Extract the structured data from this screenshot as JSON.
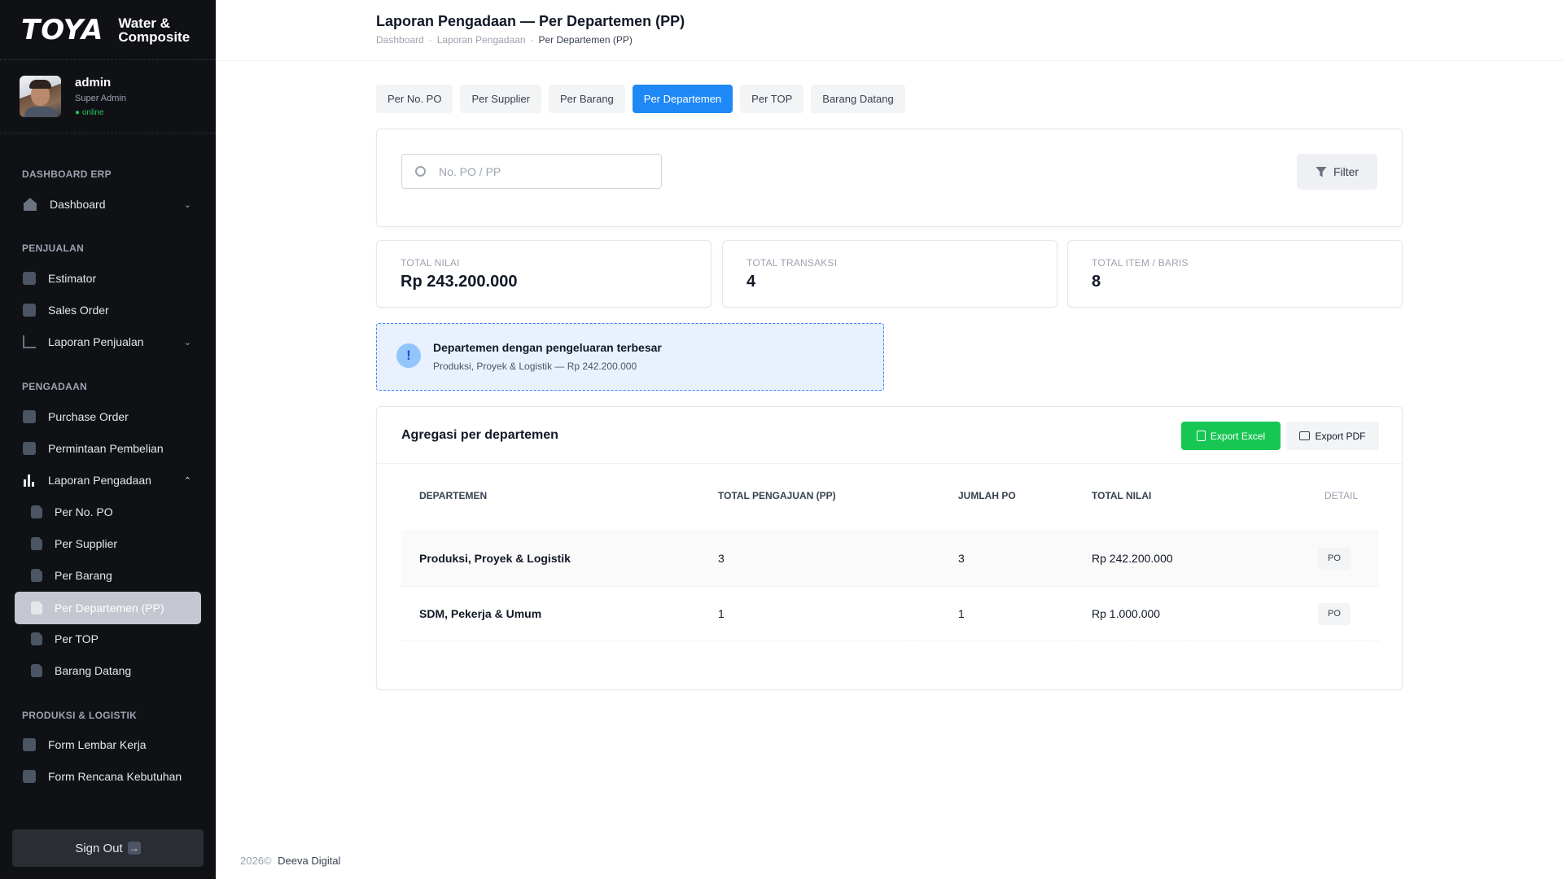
{
  "brand": {
    "logo": "TOYA",
    "sub_line1": "Water &",
    "sub_line2": "Composite"
  },
  "user": {
    "name": "admin",
    "role": "Super Admin",
    "status": "online"
  },
  "sidebar": {
    "sections": [
      "DASHBOARD ERP",
      "PENJUALAN",
      "PENGADAAN",
      "PRODUKSI & LOGISTIK"
    ],
    "items": [
      {
        "label": "Dashboard",
        "icon": "home-icon"
      },
      {
        "label": "Estimator",
        "icon": "document-icon"
      },
      {
        "label": "Sales Order",
        "icon": "document-icon"
      },
      {
        "label": "Laporan Penjualan",
        "icon": "chart-icon"
      },
      {
        "label": "Purchase Order",
        "icon": "document-icon"
      },
      {
        "label": "Permintaan Pembelian",
        "icon": "document-icon"
      },
      {
        "label": "Laporan Pengadaan",
        "icon": "bar-chart-icon"
      },
      {
        "label": "Per No. PO",
        "icon": "file-icon"
      },
      {
        "label": "Per Supplier",
        "icon": "file-icon"
      },
      {
        "label": "Per Barang",
        "icon": "file-icon"
      },
      {
        "label": "Per Departemen (PP)",
        "icon": "file-icon",
        "active": true
      },
      {
        "label": "Per TOP",
        "icon": "file-icon"
      },
      {
        "label": "Barang Datang",
        "icon": "file-icon"
      },
      {
        "label": "Form Lembar Kerja",
        "icon": "edit-icon"
      },
      {
        "label": "Form Rencana Kebutuhan",
        "icon": "edit-icon"
      }
    ],
    "signout": "Sign Out"
  },
  "header": {
    "title": "Laporan Pengadaan — Per Departemen (PP)",
    "breadcrumb": [
      "Dashboard",
      "Laporan Pengadaan",
      "Per Departemen (PP)"
    ]
  },
  "tabs": [
    "Per No. PO",
    "Per Supplier",
    "Per Barang",
    "Per Departemen",
    "Per TOP",
    "Barang Datang"
  ],
  "search": {
    "placeholder": "No. PO / PP",
    "filter_label": "Filter"
  },
  "stats": [
    {
      "label": "TOTAL NILAI",
      "value": "Rp 243.200.000"
    },
    {
      "label": "TOTAL TRANSAKSI",
      "value": "4"
    },
    {
      "label": "TOTAL ITEM / BARIS",
      "value": "8"
    }
  ],
  "alert": {
    "icon": "!",
    "title": "Departemen dengan pengeluaran terbesar",
    "subtitle": "Produksi, Proyek & Logistik — Rp 242.200.000"
  },
  "table": {
    "title": "Agregasi per departemen",
    "export_excel": "Export Excel",
    "export_pdf": "Export PDF",
    "columns": [
      "DEPARTEMEN",
      "TOTAL PENGAJUAN (PP)",
      "JUMLAH PO",
      "TOTAL NILAI",
      "DETAIL"
    ],
    "rows": [
      {
        "dept": "Produksi, Proyek & Logistik",
        "pp": "3",
        "po": "3",
        "nilai": "Rp 242.200.000",
        "detail": "PO"
      },
      {
        "dept": "SDM, Pekerja & Umum",
        "pp": "1",
        "po": "1",
        "nilai": "Rp 1.000.000",
        "detail": "PO"
      }
    ]
  },
  "footer": {
    "year": "2026©",
    "brand": "Deeva Digital"
  },
  "colors": {
    "accent": "#1e88f7",
    "success": "#17c653",
    "sidebar_bg": "#0f1115"
  }
}
